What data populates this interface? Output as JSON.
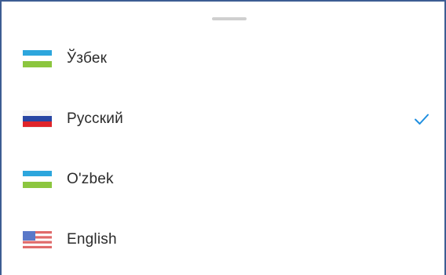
{
  "sheet": {
    "languages": [
      {
        "label": "Ўзбек",
        "flag": "uzbekistan-flag-icon",
        "selected": false,
        "colors": [
          "#2da6dd",
          "#ffffff",
          "#8cc63f"
        ]
      },
      {
        "label": "Русский",
        "flag": "russia-flag-icon",
        "selected": true,
        "colors": [
          "#ffffff",
          "#2947a3",
          "#e0252a"
        ]
      },
      {
        "label": "O'zbek",
        "flag": "uzbekistan-flag-icon",
        "selected": false,
        "colors": [
          "#2da6dd",
          "#ffffff",
          "#8cc63f"
        ]
      },
      {
        "label": "English",
        "flag": "usa-flag-icon",
        "selected": false,
        "colors": [
          "#e06a6a",
          "#ffffff",
          "#5a78c8"
        ]
      }
    ],
    "accent_color": "#1f8fe0",
    "check_icon": "check-icon"
  }
}
